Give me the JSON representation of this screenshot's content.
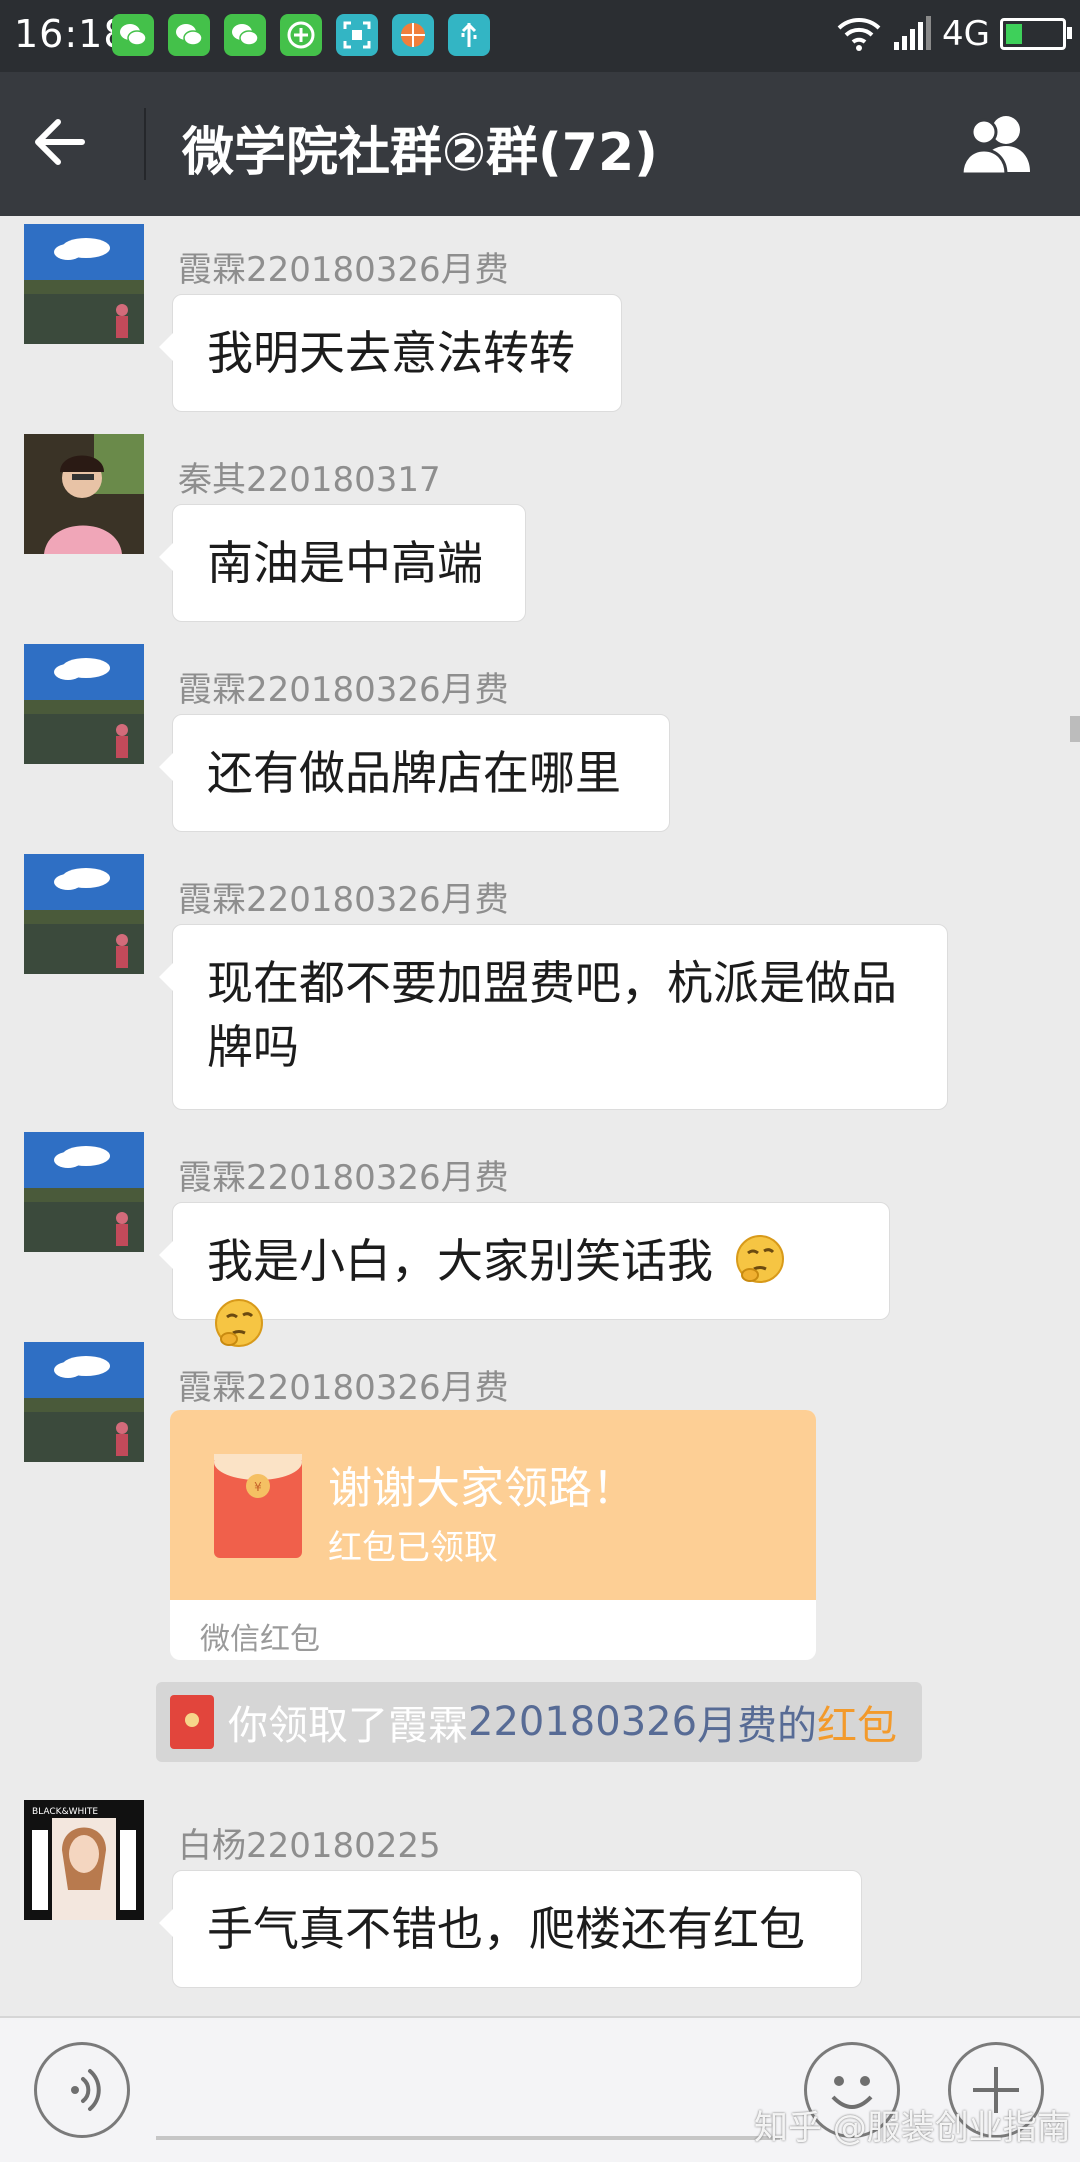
{
  "status_bar": {
    "time": "16:18",
    "network": "4G",
    "icons": [
      "wechat-icon",
      "wechat-icon",
      "wechat-icon",
      "plus-circle-icon",
      "scan-icon",
      "basketball-icon",
      "usb-icon",
      "wifi-icon",
      "signal-icon",
      "battery-charging-icon"
    ]
  },
  "header": {
    "title": "微学院社群②群(72)"
  },
  "messages": [
    {
      "sender": "霞霖220180326月费",
      "text": "我明天去意法转转"
    },
    {
      "sender": "秦其220180317",
      "text": "南油是中高端"
    },
    {
      "sender": "霞霖220180326月费",
      "text": "还有做品牌店在哪里"
    },
    {
      "sender": "霞霖220180326月费",
      "text_line1": "现在都不要加盟费吧，杭派是做品",
      "text_line2": "牌吗"
    },
    {
      "sender": "霞霖220180326月费",
      "text": "我是小白，大家别笑话我"
    },
    {
      "sender": "霞霖220180326月费"
    },
    {
      "sender": "白杨220180225",
      "text": "手气真不错也，爬楼还有红包"
    }
  ],
  "red_packet": {
    "title": "谢谢大家领路！",
    "status": "红包已领取",
    "footer": "微信红包"
  },
  "notice": {
    "prefix": "你领取了霞霖",
    "number": "220180326",
    "middle": "月费的",
    "link": "红包"
  },
  "watermark": "知乎 @服装创业指南",
  "colors": {
    "title_bar": "#373a3f",
    "status_bar": "#2b2e32",
    "chat_bg": "#ebebeb",
    "red_packet": "#fdcf95",
    "link_blue": "#576b95",
    "link_orange": "#f39a2b"
  }
}
